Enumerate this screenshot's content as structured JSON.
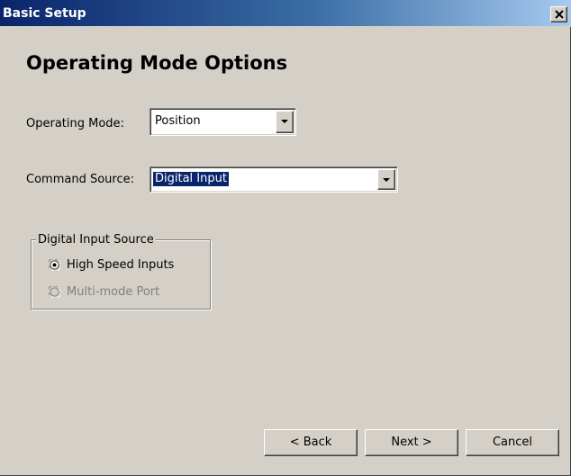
{
  "window": {
    "title": "Basic Setup",
    "close_glyph": "close-icon"
  },
  "page": {
    "heading": "Operating Mode Options"
  },
  "operating_mode": {
    "label": "Operating Mode:",
    "value": "Position"
  },
  "command_source": {
    "label": "Command Source:",
    "value": "Digital Input"
  },
  "digital_input_source": {
    "legend": "Digital Input Source",
    "options": [
      {
        "label": "High Speed Inputs",
        "checked": true,
        "enabled": true
      },
      {
        "label": "Multi-mode Port",
        "checked": false,
        "enabled": false
      }
    ]
  },
  "buttons": {
    "back": "< Back",
    "next": "Next >",
    "cancel": "Cancel"
  },
  "colors": {
    "title_bar_start": "#0a246a",
    "title_bar_end": "#a6caf0",
    "face": "#d4d0c8",
    "selection": "#0a246a",
    "disabled_text": "#808080"
  }
}
